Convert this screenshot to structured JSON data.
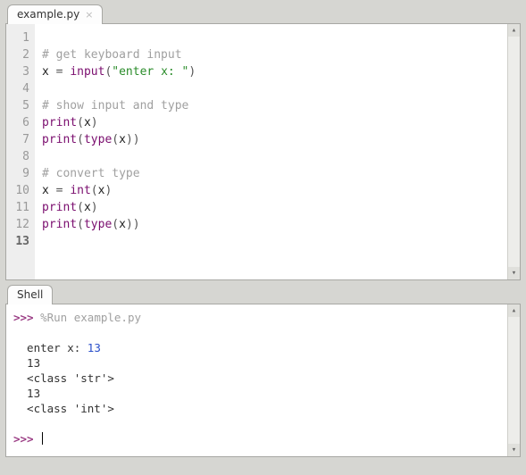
{
  "editor": {
    "tab": {
      "label": "example.py"
    },
    "lines": [
      {
        "num": "1",
        "tokens": []
      },
      {
        "num": "2",
        "tokens": [
          {
            "t": "# get keyboard input",
            "c": "tok-comment"
          }
        ]
      },
      {
        "num": "3",
        "tokens": [
          {
            "t": "x ",
            "c": "tok-name"
          },
          {
            "t": "=",
            "c": "tok-op"
          },
          {
            "t": " ",
            "c": ""
          },
          {
            "t": "input",
            "c": "tok-func"
          },
          {
            "t": "(",
            "c": "tok-paren"
          },
          {
            "t": "\"enter x: \"",
            "c": "tok-str"
          },
          {
            "t": ")",
            "c": "tok-paren"
          }
        ]
      },
      {
        "num": "4",
        "tokens": []
      },
      {
        "num": "5",
        "tokens": [
          {
            "t": "# show input and type",
            "c": "tok-comment"
          }
        ]
      },
      {
        "num": "6",
        "tokens": [
          {
            "t": "print",
            "c": "tok-func"
          },
          {
            "t": "(",
            "c": "tok-paren"
          },
          {
            "t": "x",
            "c": "tok-name"
          },
          {
            "t": ")",
            "c": "tok-paren"
          }
        ]
      },
      {
        "num": "7",
        "tokens": [
          {
            "t": "print",
            "c": "tok-func"
          },
          {
            "t": "(",
            "c": "tok-paren"
          },
          {
            "t": "type",
            "c": "tok-func"
          },
          {
            "t": "(",
            "c": "tok-paren"
          },
          {
            "t": "x",
            "c": "tok-name"
          },
          {
            "t": ")",
            "c": "tok-paren"
          },
          {
            "t": ")",
            "c": "tok-paren"
          }
        ]
      },
      {
        "num": "8",
        "tokens": []
      },
      {
        "num": "9",
        "tokens": [
          {
            "t": "# convert type",
            "c": "tok-comment"
          }
        ]
      },
      {
        "num": "10",
        "tokens": [
          {
            "t": "x ",
            "c": "tok-name"
          },
          {
            "t": "=",
            "c": "tok-op"
          },
          {
            "t": " ",
            "c": ""
          },
          {
            "t": "int",
            "c": "tok-func"
          },
          {
            "t": "(",
            "c": "tok-paren"
          },
          {
            "t": "x",
            "c": "tok-name"
          },
          {
            "t": ")",
            "c": "tok-paren"
          }
        ]
      },
      {
        "num": "11",
        "tokens": [
          {
            "t": "print",
            "c": "tok-func"
          },
          {
            "t": "(",
            "c": "tok-paren"
          },
          {
            "t": "x",
            "c": "tok-name"
          },
          {
            "t": ")",
            "c": "tok-paren"
          }
        ]
      },
      {
        "num": "12",
        "tokens": [
          {
            "t": "print",
            "c": "tok-func"
          },
          {
            "t": "(",
            "c": "tok-paren"
          },
          {
            "t": "type",
            "c": "tok-func"
          },
          {
            "t": "(",
            "c": "tok-paren"
          },
          {
            "t": "x",
            "c": "tok-name"
          },
          {
            "t": ")",
            "c": "tok-paren"
          },
          {
            "t": ")",
            "c": "tok-paren"
          }
        ]
      },
      {
        "num": "13",
        "tokens": [],
        "current": true
      }
    ]
  },
  "shell": {
    "tab": {
      "label": "Shell"
    },
    "prompt": ">>>",
    "run_cmd": "%Run example.py",
    "output": [
      {
        "text": "enter x: ",
        "input": "13"
      },
      {
        "text": "13"
      },
      {
        "text": "<class 'str'>"
      },
      {
        "text": "13"
      },
      {
        "text": "<class 'int'>"
      }
    ]
  }
}
